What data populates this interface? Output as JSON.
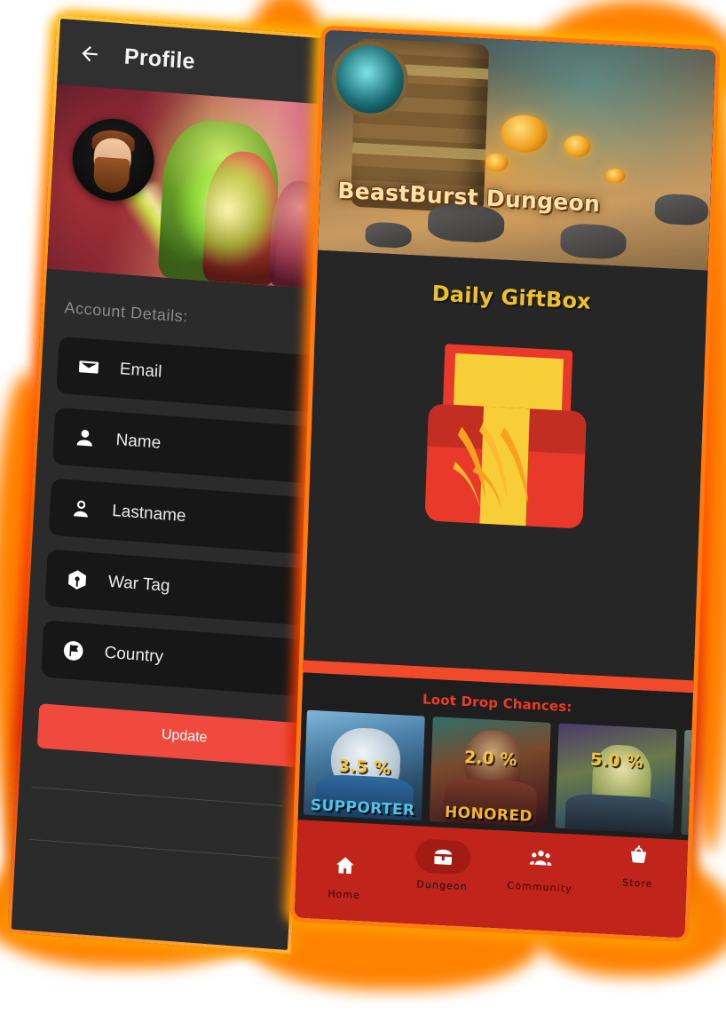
{
  "left_phone": {
    "appbar": {
      "back_icon": "arrow-left-icon",
      "title": "Profile"
    },
    "hero": {
      "avatar_alt": "player-avatar"
    },
    "section_label": "Account Details:",
    "fields": [
      {
        "icon": "envelope-icon",
        "label": "Email"
      },
      {
        "icon": "person-icon",
        "label": "Name"
      },
      {
        "icon": "person-outline-icon",
        "label": "Lastname"
      },
      {
        "icon": "cube-icon",
        "label": "War Tag"
      },
      {
        "icon": "flag-circle-icon",
        "label": "Country"
      }
    ],
    "update_button": {
      "label": "Update",
      "color": "#F04A3F"
    }
  },
  "right_phone": {
    "banner": {
      "title": "BeastBurst Dungeon",
      "title_color": "#FAE3A8"
    },
    "giftbox": {
      "title": "Daily GiftBox",
      "title_color": "#F0C02A",
      "box_red": "#E8392B",
      "box_yellow": "#F8CE38"
    },
    "divider_color": "#F04A2A",
    "loot": {
      "title": "Loot Drop Chances:",
      "title_color": "#F03B22",
      "cards": [
        {
          "percent": "3.5 %",
          "name": "SUPPORTER",
          "name_color": "#4FC3E8"
        },
        {
          "percent": "2.0 %",
          "name": "HONORED",
          "name_color": "#F2B431"
        },
        {
          "percent": "5.0 %",
          "name": "",
          "name_color": "#F2B431"
        },
        {
          "percent": "",
          "name": "",
          "name_color": "#F2B431"
        }
      ]
    },
    "nav": {
      "background": "#C0241A",
      "items": [
        {
          "icon": "home-icon",
          "label": "Home",
          "active": false
        },
        {
          "icon": "treasure-chest-icon",
          "label": "Dungeon",
          "active": true
        },
        {
          "icon": "community-icon",
          "label": "Community",
          "active": false
        },
        {
          "icon": "store-basket-icon",
          "label": "Store",
          "active": false
        }
      ]
    }
  },
  "background": {
    "glow_color": "#FF8200"
  }
}
